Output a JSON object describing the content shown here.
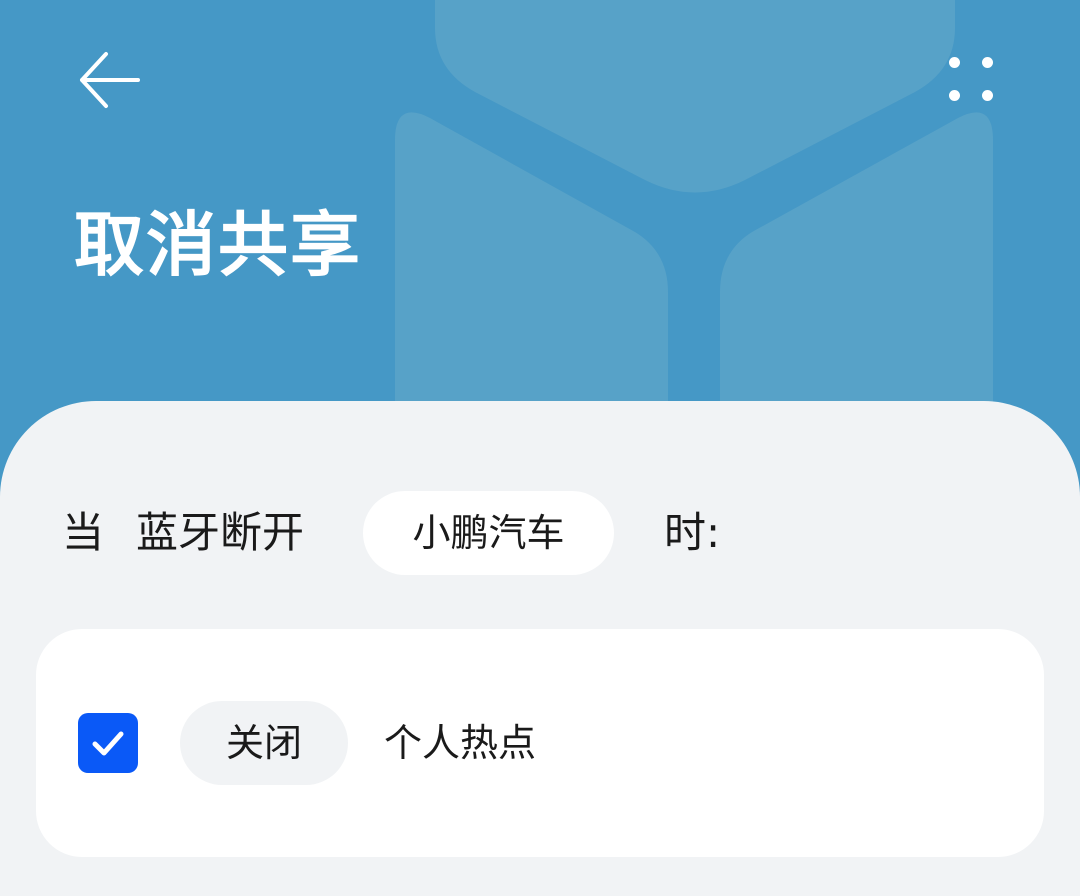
{
  "header": {
    "title": "取消共享",
    "back_icon": "arrow-left-icon",
    "more_icon": "more-dots-icon",
    "background_color": "#4598c6"
  },
  "condition": {
    "prefix": "当",
    "event": "蓝牙断开",
    "device": "小鹏汽车",
    "suffix": "时:"
  },
  "action": {
    "checked": true,
    "checkbox_color": "#0a59f7",
    "operation": "关闭",
    "target": "个人热点"
  }
}
